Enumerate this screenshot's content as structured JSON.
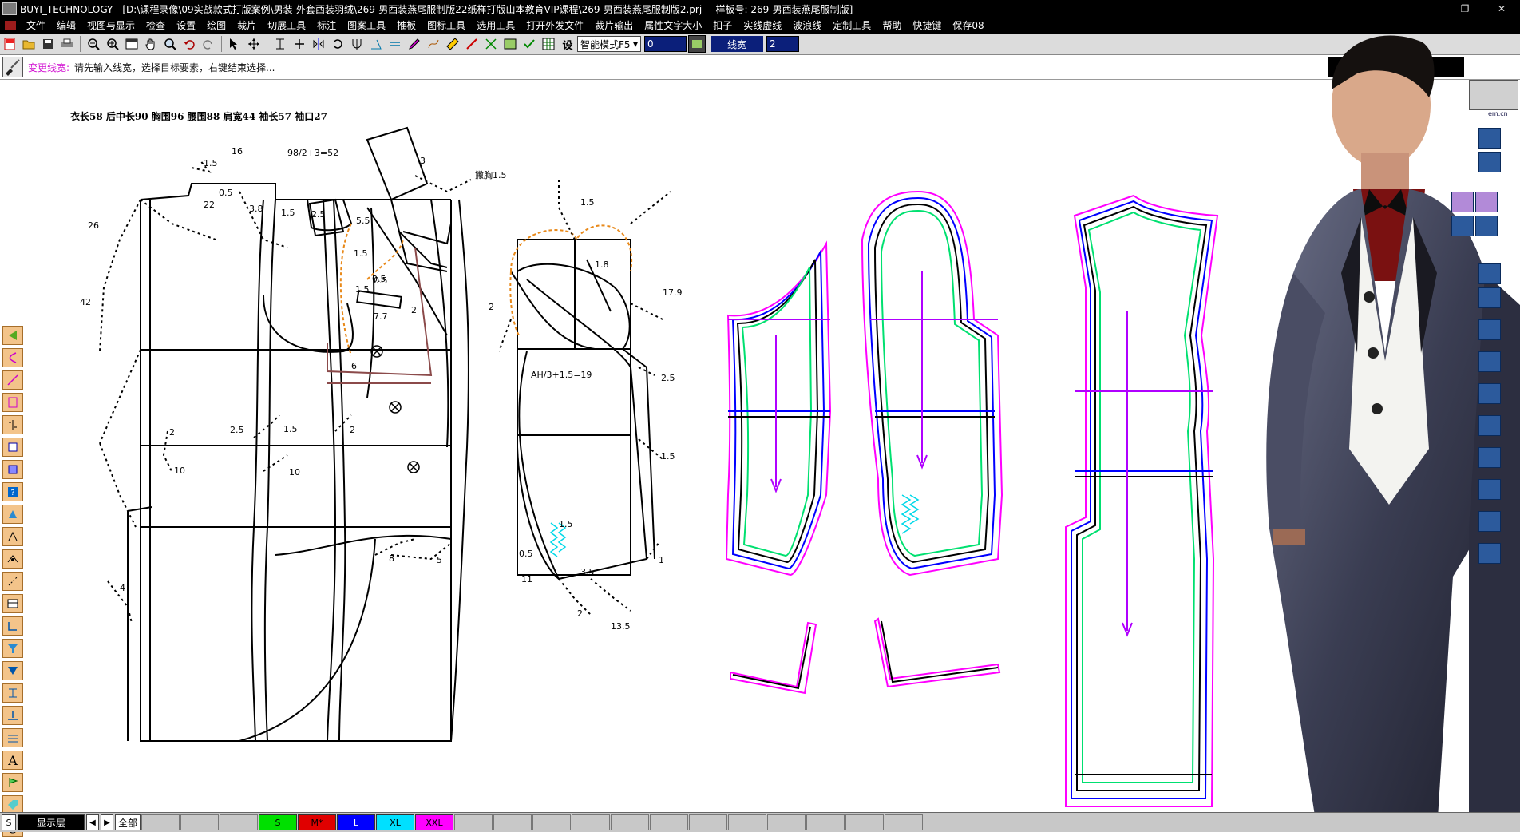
{
  "window": {
    "title": "BUYI_TECHNOLOGY - [D:\\课程录像\\09实战款式打版案例\\男装-外套西装羽绒\\269-男西装燕尾服制版22纸样打版山本教育VIP课程\\269-男西装燕尾服制版2.prj----样板号: 269-男西装燕尾服制版]",
    "restore_glyph": "❐",
    "close_glyph": "✕"
  },
  "menu": [
    "文件",
    "编辑",
    "视图与显示",
    "检查",
    "设置",
    "绘图",
    "裁片",
    "切展工具",
    "标注",
    "图案工具",
    "推板",
    "图标工具",
    "选用工具",
    "打开外发文件",
    "裁片输出",
    "属性文字大小",
    "扣子",
    "实线虚线",
    "波浪线",
    "定制工具",
    "帮助",
    "快捷键",
    "保存08"
  ],
  "toolbar": {
    "set_label": "设",
    "mode_select": "智能模式F5",
    "value1": "0",
    "linewidth_label": "线宽",
    "linewidth_value": "2"
  },
  "status": {
    "command": "变更线宽:",
    "message": "请先输入线宽，选择目标要素，右键结束选择..."
  },
  "drawing": {
    "measurements": "衣长58   后中长90   胸围96   腰围88   肩宽44   袖长57   袖口27",
    "labels": [
      "1.5",
      "16",
      "98/2+3=52",
      "0.5",
      "22",
      "1.5",
      "26",
      "42",
      "2",
      "10",
      "2.5",
      "1.5",
      "10",
      "2",
      "1.5",
      "3.8",
      "2.5",
      "5.5",
      "0.5",
      "1.5",
      "0.5",
      "7.7",
      "2",
      "6",
      "4",
      "8",
      "5",
      "3",
      "撇胸1.5",
      "1.5",
      "1.8",
      "2",
      "17.9",
      "AH/3+1.5=19",
      "2.5",
      "1.5",
      "1.5",
      "0.5",
      "11",
      "3.5",
      "2",
      "13.5",
      "1"
    ],
    "text_glyph": "A"
  },
  "bottom": {
    "s_label": "S",
    "layer_label": "显示层",
    "all_label": "全部",
    "sizes": [
      {
        "name": "S",
        "color": "#00e000",
        "text": "#000000"
      },
      {
        "name": "M*",
        "color": "#e00000",
        "text": "#000000"
      },
      {
        "name": "L",
        "color": "#0000ff",
        "text": "#ffffff"
      },
      {
        "name": "XL",
        "color": "#00e0ff",
        "text": "#000000"
      },
      {
        "name": "XXL",
        "color": "#ff00ff",
        "text": "#000000"
      }
    ]
  },
  "watermark": "em.cn"
}
